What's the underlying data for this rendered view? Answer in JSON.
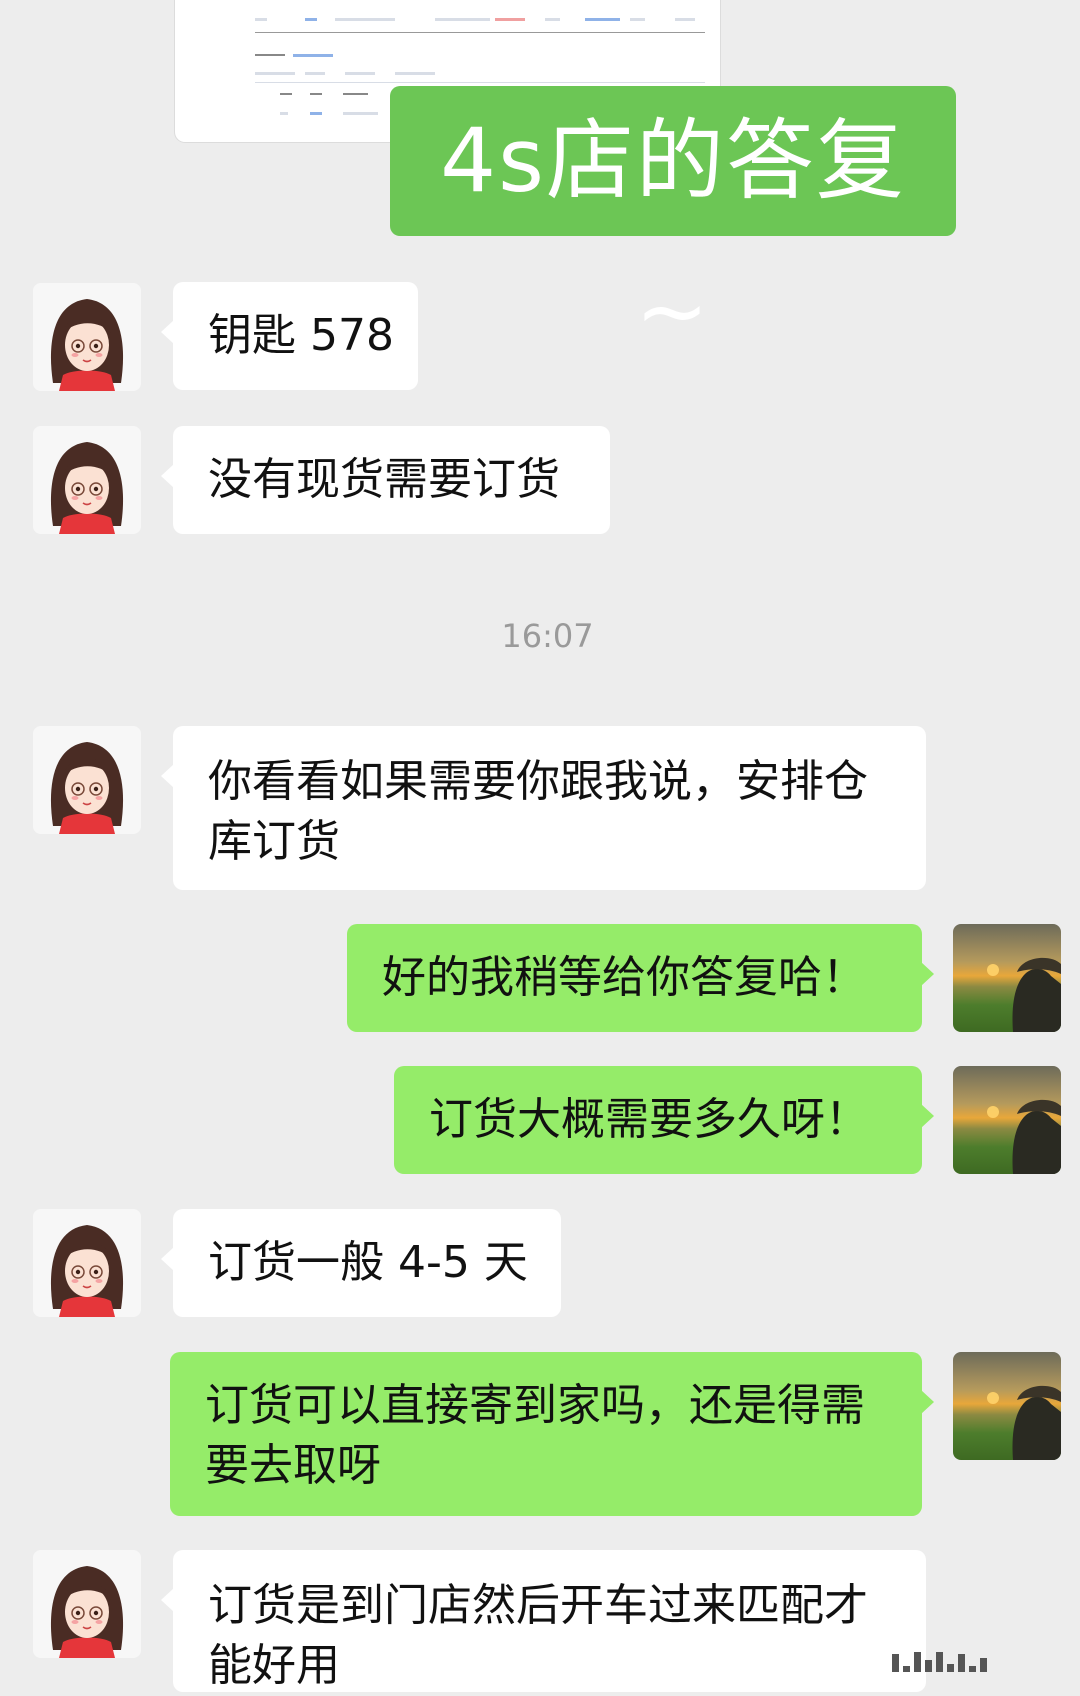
{
  "overlay_title": "4s店的答复 ~",
  "timestamp": "16:07",
  "messages": [
    {
      "side": "in",
      "text": "钥匙 578"
    },
    {
      "side": "in",
      "text": "没有现货需要订货"
    },
    {
      "side": "in",
      "text": "你看看如果需要你跟我说，安排仓库订货"
    },
    {
      "side": "out",
      "text": "好的我稍等给你答复哈！"
    },
    {
      "side": "out",
      "text": "订货大概需要多久呀！"
    },
    {
      "side": "in",
      "text": "订货一般 4-5 天"
    },
    {
      "side": "out",
      "text": "订货可以直接寄到家吗，还是得需要去取呀"
    },
    {
      "side": "in",
      "text": "订货是到门店然后开车过来匹配才能好用"
    }
  ],
  "icons": {
    "contact_avatar": "cartoon-girl-with-glasses-avatar-icon",
    "self_avatar": "sunset-field-photo-avatar"
  },
  "colors": {
    "background": "#ededed",
    "incoming_bubble": "#ffffff",
    "outgoing_bubble": "#95ec69",
    "overlay_title_bg": "#6cc655"
  }
}
